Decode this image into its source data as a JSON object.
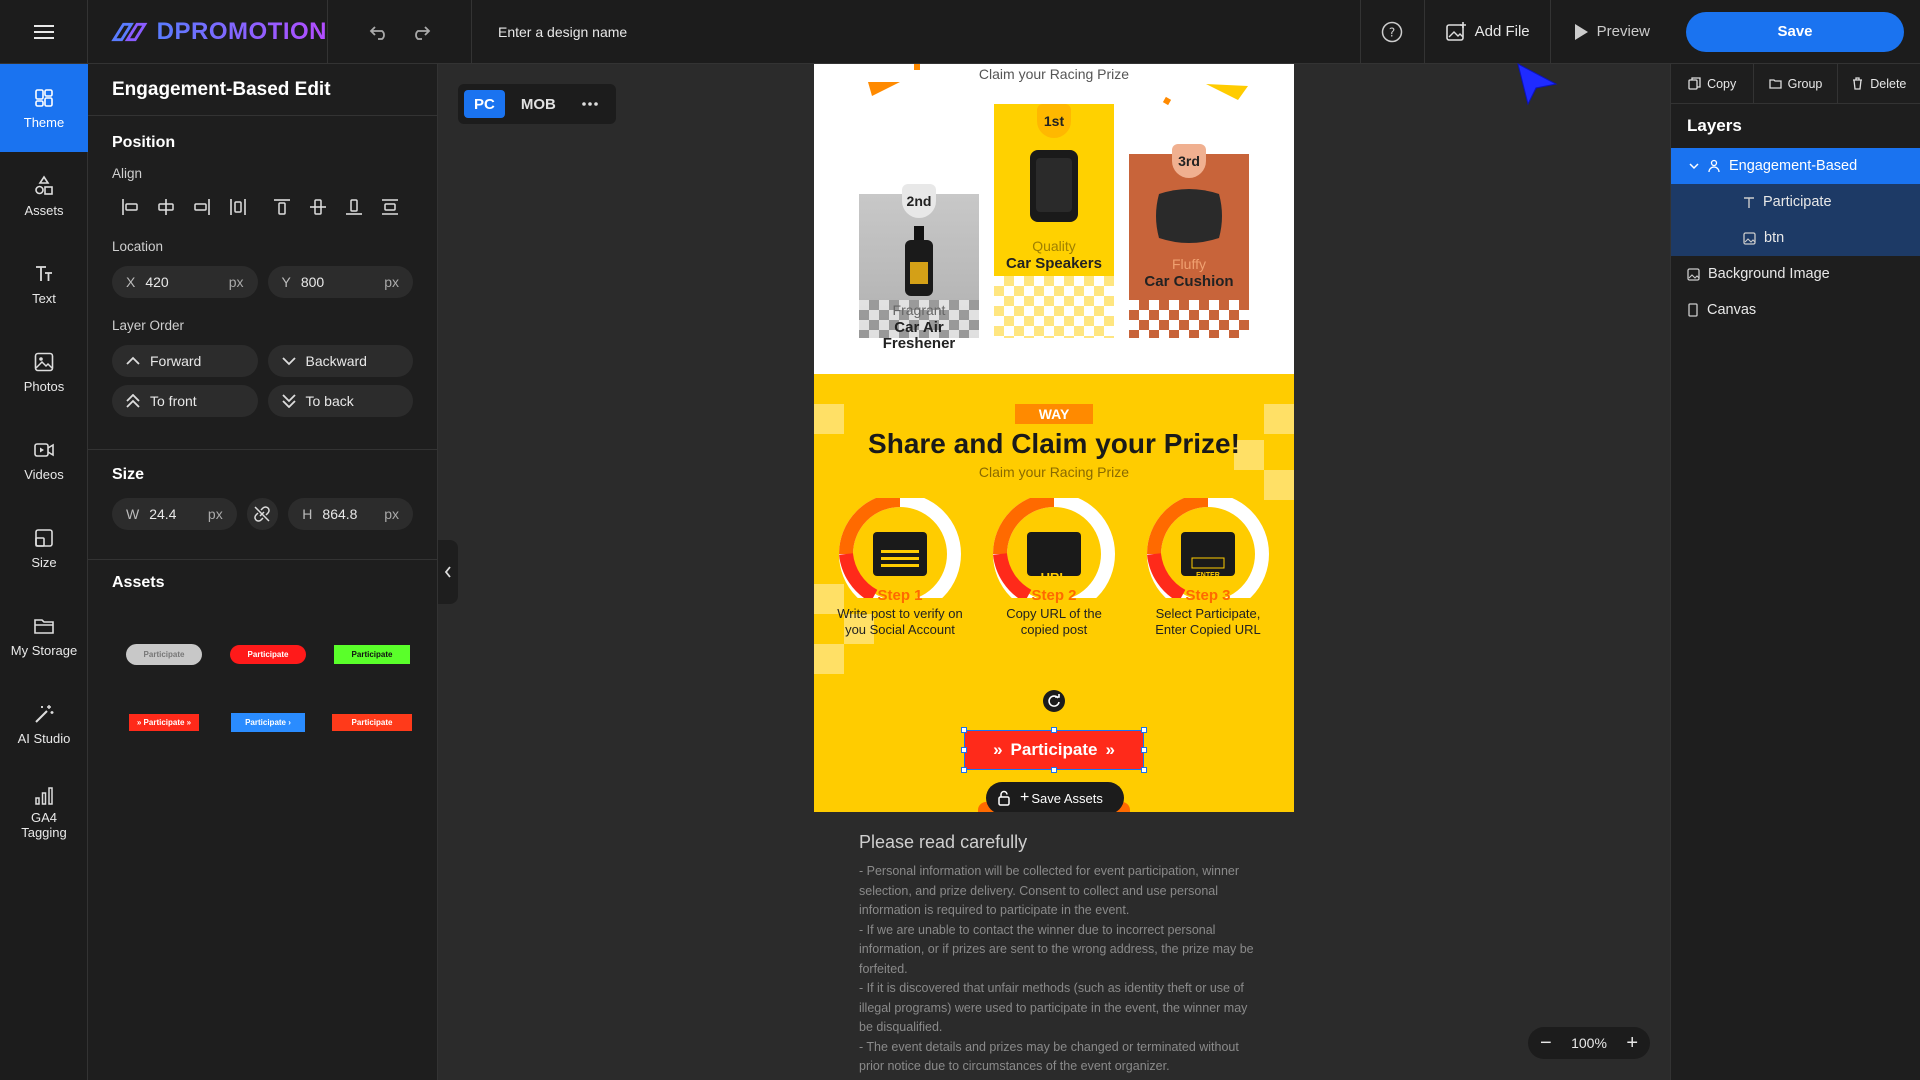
{
  "app": {
    "logo_text": "DPROMOTION",
    "design_name_placeholder": "Enter a design name",
    "add_file_label": "Add File",
    "preview_label": "Preview",
    "save_label": "Save"
  },
  "rail": [
    {
      "label": "Theme",
      "icon": "theme-icon",
      "active": true
    },
    {
      "label": "Assets",
      "icon": "assets-icon"
    },
    {
      "label": "Text",
      "icon": "text-icon"
    },
    {
      "label": "Photos",
      "icon": "photos-icon"
    },
    {
      "label": "Videos",
      "icon": "videos-icon"
    },
    {
      "label": "Size",
      "icon": "size-icon"
    },
    {
      "label": "My Storage",
      "icon": "folder-icon"
    },
    {
      "label": "AI Studio",
      "icon": "magic-wand-icon"
    },
    {
      "label": "GA4\nTagging",
      "icon": "analytics-icon"
    }
  ],
  "props": {
    "title": "Engagement-Based Edit",
    "position_title": "Position",
    "align_label": "Align",
    "location_label": "Location",
    "x_label": "X",
    "x_value": "420",
    "y_label": "Y",
    "y_value": "800",
    "unit": "px",
    "layer_order_label": "Layer Order",
    "forward": "Forward",
    "backward": "Backward",
    "to_front": "To front",
    "to_back": "To back",
    "size_title": "Size",
    "w_label": "W",
    "w_value": "24.4",
    "h_label": "H",
    "h_value": "864.8",
    "assets_title": "Assets",
    "asset_buttons": [
      "Participate",
      "Participate",
      "Participate",
      "» Participate »",
      "Participate ›",
      "Participate"
    ]
  },
  "device": {
    "pc": "PC",
    "mob": "MOB"
  },
  "canvas": {
    "claim_top": "Claim your Racing Prize",
    "prizes": [
      {
        "rank": "2nd",
        "sub": "Fragrant",
        "name": "Car Air Freshener"
      },
      {
        "rank": "1st",
        "sub": "Quality",
        "name": "Car Speakers"
      },
      {
        "rank": "3rd",
        "sub": "Fluffy",
        "name": "Car Cushion"
      }
    ],
    "way": "WAY",
    "share_title": "Share and Claim your Prize!",
    "claim_sub": "Claim your Racing Prize",
    "steps": [
      {
        "label": "Step 1",
        "desc": "Write post to verify on you Social Account",
        "screen": ""
      },
      {
        "label": "Step 2",
        "desc": "Copy URL of the copied post",
        "screen": "URL"
      },
      {
        "label": "Step 3",
        "desc": "Select Participate, Enter Copied URL",
        "screen": "ENTER"
      }
    ],
    "participate": "Participate",
    "save_assets": "Save Assets",
    "read_title": "Please read carefully",
    "read_body": [
      "- Personal information will be collected for event participation, winner selection, and prize delivery. Consent to collect and use personal information is required to participate in the event.",
      "- If we are unable to contact the winner due to incorrect personal information, or if prizes are sent to the wrong address, the prize may be forfeited.",
      "- If it is discovered that unfair methods (such as identity theft or use of illegal programs) were used to participate in the event, the winner may be disqualified.",
      "- The event details and prizes may be changed or terminated without prior notice due to circumstances of the event organizer."
    ]
  },
  "zoom": {
    "value": "100%"
  },
  "right": {
    "copy": "Copy",
    "group": "Group",
    "delete": "Delete",
    "layers_title": "Layers",
    "layers": [
      {
        "label": "Engagement-Based",
        "level": 0,
        "active": true
      },
      {
        "label": "Participate",
        "level": 1
      },
      {
        "label": "btn",
        "level": 1
      },
      {
        "label": "Background Image",
        "level": 0
      },
      {
        "label": "Canvas",
        "level": 0
      }
    ]
  },
  "colors": {
    "accent": "#1a73f0",
    "event_yellow": "#ffcc00",
    "event_orange": "#ff6a00",
    "participate_red": "#ff2a1a"
  }
}
